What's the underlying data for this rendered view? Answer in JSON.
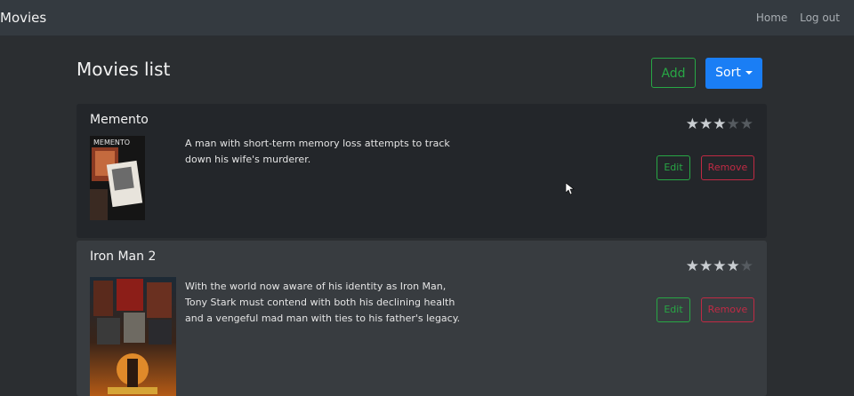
{
  "navbar": {
    "brand": "Movies",
    "links": [
      "Home",
      "Log out"
    ]
  },
  "page": {
    "title": "Movies list",
    "add_label": "Add",
    "sort_label": "Sort"
  },
  "movies": [
    {
      "title": "Memento",
      "description": "A man with short-term memory loss attempts to track down his wife's murderer.",
      "rating": 3,
      "max_rating": 5,
      "poster_text": "MEMENTO",
      "edit_label": "Edit",
      "remove_label": "Remove"
    },
    {
      "title": "Iron Man 2",
      "description": "With the world now aware of his identity as Iron Man, Tony Stark must contend with both his declining health and a vengeful mad man with ties to his father's legacy.",
      "rating": 4,
      "max_rating": 5,
      "edit_label": "Edit",
      "remove_label": "Remove"
    }
  ],
  "colors": {
    "success": "#28a745",
    "danger": "#c02a44",
    "primary": "#1a7ef5",
    "star_on": "#c9cdd1",
    "star_off": "#565b60"
  }
}
